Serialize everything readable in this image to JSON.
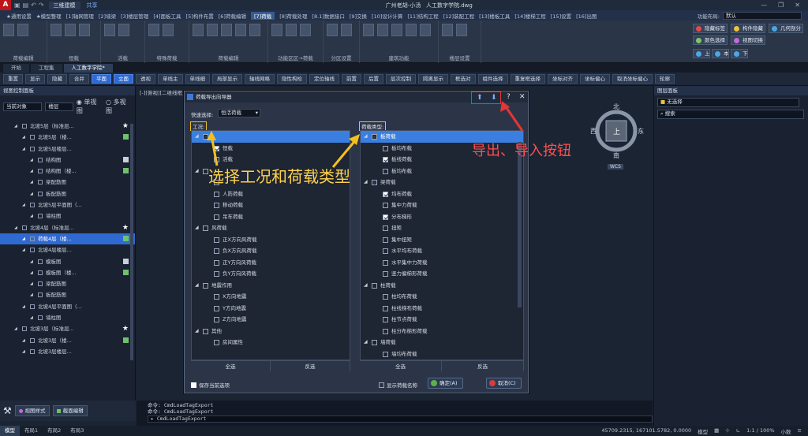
{
  "titlebar": {
    "workspace": "三维建模",
    "share": "共享",
    "user": "广州老胡-小汤",
    "doc_title": "人工数字学院.dwg"
  },
  "ribbon_tabs": [
    "★通用设置",
    "★模型整理",
    "[1]轴网管理",
    "[2]墙梁",
    "[3]楼层管理",
    "[4]面板工具",
    "[5]构件布置",
    "[6]荷载编辑",
    "[7]荷载",
    "[8]荷载处理",
    "[8.1]数据接口",
    "[9]交换",
    "[10]设计计算",
    "[11]结构工程",
    "[12]装配工程",
    "[13]楼板工具",
    "[14]楼梯工程",
    "[15]设置",
    "[16]出图"
  ],
  "ribbon_active_tab": "[7]荷载",
  "ribbon_right": {
    "label": "功能布局:",
    "value": "默认"
  },
  "ribbon_groups": [
    "荷载编辑",
    "恒载",
    "活载",
    "特殊荷载",
    "荷载编辑",
    "功能区区→荷载",
    "分区设置",
    "建筑功能",
    "楼层设置"
  ],
  "ribbon_right_buttons": [
    {
      "label": "隐藏标签",
      "color": "#e24a4a"
    },
    {
      "label": "构件隐藏",
      "color": "#f0c23c"
    },
    {
      "label": "几何剖分",
      "color": "#4aa8e2"
    },
    {
      "label": "颜色选择",
      "color": "#7bc66a"
    },
    {
      "label": "视图切换",
      "color": "#c46ad8"
    },
    {
      "label": "上层",
      "color": "#4aa8e2"
    },
    {
      "label": "本层",
      "color": "#4aa8e2"
    },
    {
      "label": "下层",
      "color": "#4aa8e2"
    }
  ],
  "doc_tabs": [
    "开始",
    "工程集",
    "人工数字学院*"
  ],
  "toolbar": [
    "重置",
    "显示",
    "隐藏",
    "合并",
    "平面",
    "立面",
    "透视",
    "单线主",
    "单线细",
    "局部显示",
    "轴线网格",
    "隐性构检",
    "定位轴线",
    "前置",
    "后置",
    "层次控制",
    "隔离显示",
    "框选对",
    "组件选择",
    "重复框选择",
    "坐标对齐",
    "坐标偏心",
    "取消坐标偏心",
    "轮廓"
  ],
  "toolbar_highlight": [
    4,
    5
  ],
  "left_panel": {
    "title": "视图控制面板",
    "filter1": "当前对象",
    "filter2": "楼层",
    "radio1": "单视图",
    "radio2": "多视图",
    "tree": [
      {
        "text": "北坡5层（标准层...",
        "indent": 1,
        "star": true
      },
      {
        "text": "北坡5层（楼...",
        "indent": 2,
        "icon": "#6fc16a"
      },
      {
        "text": "北坡5层楼层...",
        "indent": 2
      },
      {
        "text": "结构图",
        "indent": 3,
        "icon": "#c8cfd9"
      },
      {
        "text": "结构图（楼...",
        "indent": 3,
        "icon": "#6fc16a"
      },
      {
        "text": "梁配筋图",
        "indent": 3
      },
      {
        "text": "板配筋图",
        "indent": 3
      },
      {
        "text": "北坡5层平面图（...",
        "indent": 2
      },
      {
        "text": "墙柱图",
        "indent": 3
      },
      {
        "text": "北坡4层（标准层...",
        "indent": 1,
        "star": true
      },
      {
        "text": "荷载4层（楼...",
        "indent": 2,
        "selected": true,
        "icon": "#6fc16a"
      },
      {
        "text": "北坡4层楼层...",
        "indent": 2
      },
      {
        "text": "模板图",
        "indent": 3,
        "icon": "#c8cfd9"
      },
      {
        "text": "模板图（楼...",
        "indent": 3,
        "icon": "#6fc16a"
      },
      {
        "text": "梁配筋图",
        "indent": 3
      },
      {
        "text": "板配筋图",
        "indent": 3
      },
      {
        "text": "北坡4层平面图（...",
        "indent": 2
      },
      {
        "text": "墙柱图",
        "indent": 3
      },
      {
        "text": "北坡3层（标准层...",
        "indent": 1,
        "star": true
      },
      {
        "text": "北坡3层（楼...",
        "indent": 2,
        "icon": "#6fc16a"
      },
      {
        "text": "北坡3层楼层...",
        "indent": 2
      }
    ],
    "bottom_buttons": [
      "视图样式",
      "截面编辑"
    ]
  },
  "canvas": {
    "view_label": "[-][俯视][二维线框]",
    "compass": {
      "north": "北",
      "south": "南",
      "east": "东",
      "west": "西",
      "center": "上",
      "ucs": "WCS"
    }
  },
  "right_panel": {
    "title": "图层面板",
    "select": "无选择",
    "search": "搜索"
  },
  "dialog": {
    "title": "荷载导出向导器",
    "quick_label": "快速选择:",
    "quick_value": "恒活荷载",
    "left_header": "工况:",
    "right_header": "荷载类型:",
    "left_rows": [
      {
        "text": "",
        "level": 0,
        "hd": true,
        "expand": "▲",
        "cb": "part"
      },
      {
        "text": "恒载",
        "level": 1,
        "cb": "on"
      },
      {
        "text": "活载",
        "level": 1,
        "cb": "off"
      },
      {
        "text": "",
        "level": 0,
        "expand": "▲",
        "cb": "off"
      },
      {
        "text": "",
        "level": 1,
        "cb": "off"
      },
      {
        "text": "人防荷载",
        "level": 1,
        "cb": "off"
      },
      {
        "text": "移动荷载",
        "level": 1,
        "cb": "off"
      },
      {
        "text": "吊车荷载",
        "level": 1,
        "cb": "off"
      },
      {
        "text": "风荷载",
        "level": 0,
        "expand": "▲",
        "cb": "off"
      },
      {
        "text": "正X方向风荷载",
        "level": 1,
        "cb": "off"
      },
      {
        "text": "负X方向风荷载",
        "level": 1,
        "cb": "off"
      },
      {
        "text": "正Y方向风荷载",
        "level": 1,
        "cb": "off"
      },
      {
        "text": "负Y方向风荷载",
        "level": 1,
        "cb": "off"
      },
      {
        "text": "地震作用",
        "level": 0,
        "expand": "▲",
        "cb": "off"
      },
      {
        "text": "X方向地震",
        "level": 1,
        "cb": "off"
      },
      {
        "text": "Y方向地震",
        "level": 1,
        "cb": "off"
      },
      {
        "text": "Z方向地震",
        "level": 1,
        "cb": "off"
      },
      {
        "text": "其他",
        "level": 0,
        "expand": "▲",
        "cb": "off"
      },
      {
        "text": "房间属性",
        "level": 1,
        "cb": "off"
      }
    ],
    "right_rows": [
      {
        "text": "板荷载",
        "level": 0,
        "hd": true,
        "expand": "▲",
        "cb": "part"
      },
      {
        "text": "板均布载",
        "level": 1,
        "cb": "off"
      },
      {
        "text": "板线荷载",
        "level": 1,
        "cb": "on"
      },
      {
        "text": "板均布载",
        "level": 1,
        "cb": "off"
      },
      {
        "text": "梁荷载",
        "level": 0,
        "expand": "▲",
        "cb": "part"
      },
      {
        "text": "均布荷载",
        "level": 1,
        "cb": "on"
      },
      {
        "text": "集中力荷载",
        "level": 1,
        "cb": "off"
      },
      {
        "text": "分布梯形",
        "level": 1,
        "cb": "on"
      },
      {
        "text": "扭矩",
        "level": 1,
        "cb": "off"
      },
      {
        "text": "集中扭矩",
        "level": 1,
        "cb": "off"
      },
      {
        "text": "水平均布荷载",
        "level": 1,
        "cb": "off"
      },
      {
        "text": "水平集中力荷载",
        "level": 1,
        "cb": "off"
      },
      {
        "text": "竖力偏梯形荷载",
        "level": 1,
        "cb": "off"
      },
      {
        "text": "柱荷载",
        "level": 0,
        "expand": "▲",
        "cb": "off"
      },
      {
        "text": "柱均布荷载",
        "level": 1,
        "cb": "off"
      },
      {
        "text": "柱线梯布荷载",
        "level": 1,
        "cb": "off"
      },
      {
        "text": "柱节点荷载",
        "level": 1,
        "cb": "off"
      },
      {
        "text": "柱分布梯形荷载",
        "level": 1,
        "cb": "off"
      },
      {
        "text": "墙荷载",
        "level": 0,
        "expand": "▲",
        "cb": "off"
      },
      {
        "text": "墙均布荷载",
        "level": 1,
        "cb": "off"
      }
    ],
    "select_all": "全选",
    "invert": "反选",
    "save_current": "保存当前选项",
    "show_names": "显示荷载名称",
    "ok": "确定(A)",
    "cancel": "取消(C)"
  },
  "annotations": {
    "select_text": "选择工况和荷载类型",
    "export_text": "导出、导入按钮"
  },
  "command": {
    "line1": "命令: CmdLoadTagExport",
    "line2": "命令: CmdLoadTagExport",
    "input": "CmdLoadTagExport"
  },
  "status": {
    "layouts": [
      "模型",
      "布局1",
      "布局2",
      "布局3"
    ],
    "coords": "45709.2315, 167101.5782, 0.0000",
    "mode": "模型",
    "scale": "1:1 / 100%",
    "units": "小数"
  }
}
